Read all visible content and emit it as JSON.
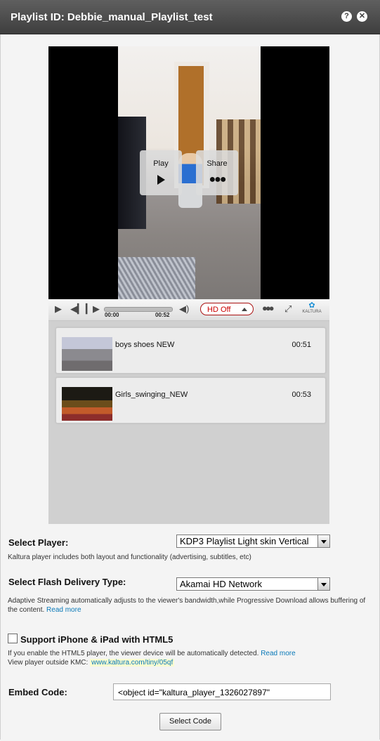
{
  "window": {
    "title": "Playlist ID: Debbie_manual_Playlist_test",
    "help_icon": "question-icon",
    "close_icon": "close-icon"
  },
  "player": {
    "overlay": {
      "play_label": "Play",
      "share_label": "Share"
    },
    "controls": {
      "time_current": "00:00",
      "time_total": "00:52",
      "hd_label": "HD Off",
      "brand": "KALTURA"
    }
  },
  "playlist": {
    "items": [
      {
        "title": "boys shoes NEW",
        "duration": "00:51"
      },
      {
        "title": "Girls_swinging_NEW",
        "duration": "00:53"
      }
    ]
  },
  "settings": {
    "select_player": {
      "label": "Select Player:",
      "value": "KDP3 Playlist Light skin Vertical",
      "help": "Kaltura player includes both layout and functionality (advertising, subtitles, etc)"
    },
    "delivery": {
      "label": "Select Flash Delivery Type:",
      "value": "Akamai HD Network",
      "help": "Adaptive Streaming automatically adjusts to the viewer's bandwidth,while Progressive Download allows buffering of the content.",
      "link": "Read more"
    },
    "html5": {
      "label": "Support iPhone & iPad with HTML5",
      "checked": false,
      "help": "If you enable the HTML5 player, the viewer device will be automatically detected.",
      "link": "Read more",
      "outside_label": "View player outside KMC:",
      "outside_url": "www.kaltura.com/tiny/05qf"
    },
    "embed": {
      "label": "Embed Code:",
      "value": "<object id=\"kaltura_player_1326027897\"",
      "button": "Select Code"
    }
  }
}
